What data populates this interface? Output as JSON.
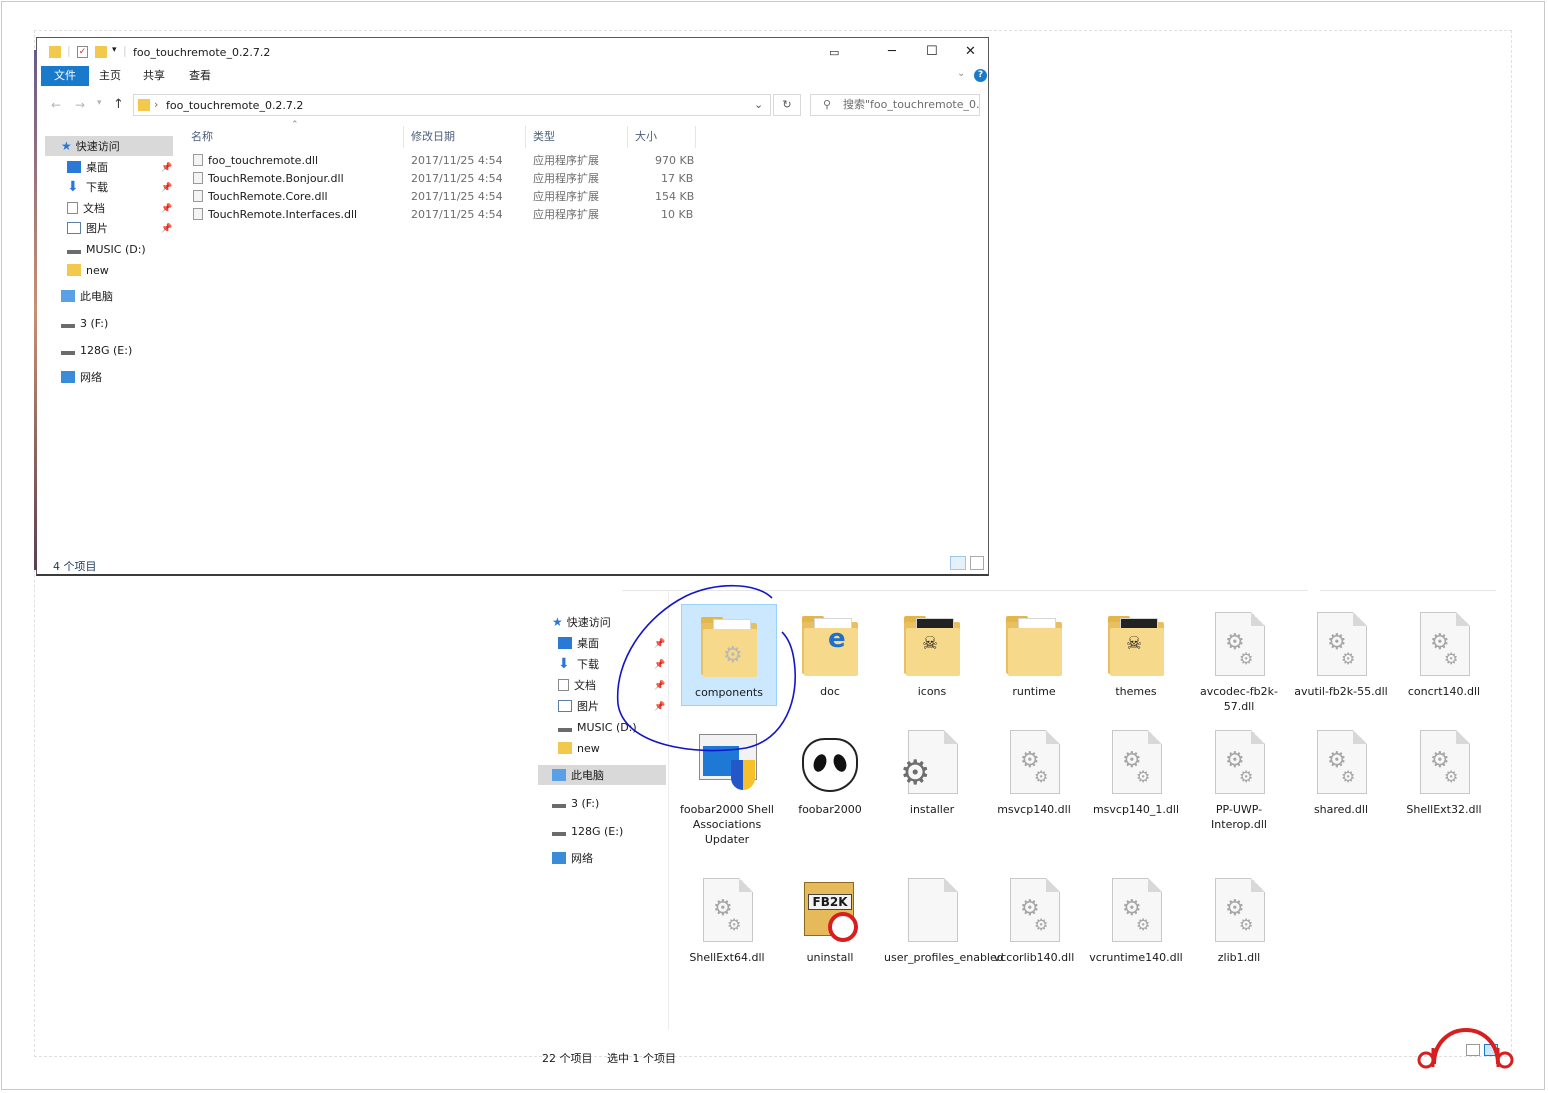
{
  "window": {
    "title": "foo_touchremote_0.2.7.2",
    "ribbon_tabs": [
      "文件",
      "主页",
      "共享",
      "查看"
    ],
    "address_path": "foo_touchremote_0.2.7.2",
    "search_placeholder": "搜索\"foo_touchremote_0.2...",
    "columns": {
      "name": "名称",
      "modified": "修改日期",
      "type": "类型",
      "size": "大小"
    },
    "files": [
      {
        "name": "foo_touchremote.dll",
        "modified": "2017/11/25 4:54",
        "type": "应用程序扩展",
        "size": "970 KB"
      },
      {
        "name": "TouchRemote.Bonjour.dll",
        "modified": "2017/11/25 4:54",
        "type": "应用程序扩展",
        "size": "17 KB"
      },
      {
        "name": "TouchRemote.Core.dll",
        "modified": "2017/11/25 4:54",
        "type": "应用程序扩展",
        "size": "154 KB"
      },
      {
        "name": "TouchRemote.Interfaces.dll",
        "modified": "2017/11/25 4:54",
        "type": "应用程序扩展",
        "size": "10 KB"
      }
    ],
    "status": "4 个项目"
  },
  "nav": {
    "quick_access": "快速访问",
    "desktop": "桌面",
    "downloads": "下载",
    "documents": "文档",
    "pictures": "图片",
    "music": "MUSIC (D:)",
    "new": "new",
    "this_pc": "此电脑",
    "drive_f": "3 (F:)",
    "drive_e": "128G (E:)",
    "network": "网络"
  },
  "back_nav": {
    "quick_access": "快速访问",
    "desktop": "桌面",
    "downloads": "下载",
    "documents": "文档",
    "pictures": "图片",
    "music": "MUSIC (D:)",
    "new": "new",
    "this_pc": "此电脑",
    "drive_f": "3 (F:)",
    "drive_e": "128G (E:)",
    "network": "网络"
  },
  "back_items": [
    "components",
    "doc",
    "icons",
    "runtime",
    "themes",
    "avcodec-fb2k-57.dll",
    "avutil-fb2k-55.dll",
    "concrt140.dll",
    "foobar2000 Shell Associations Updater",
    "foobar2000",
    "installer",
    "msvcp140.dll",
    "msvcp140_1.dll",
    "PP-UWP-Interop.dll",
    "shared.dll",
    "ShellExt32.dll",
    "ShellExt64.dll",
    "uninstall",
    "user_profiles_enabled",
    "vccorlib140.dll",
    "vcruntime140.dll",
    "zlib1.dll"
  ],
  "back_status": {
    "count": "22 个项目",
    "selected": "选中 1 个项目"
  },
  "icon_text": {
    "fb2k": "FB2K"
  },
  "colors": {
    "accent": "#1979ca",
    "annotation": "#1414c8",
    "watermark": "#d81e1e"
  }
}
